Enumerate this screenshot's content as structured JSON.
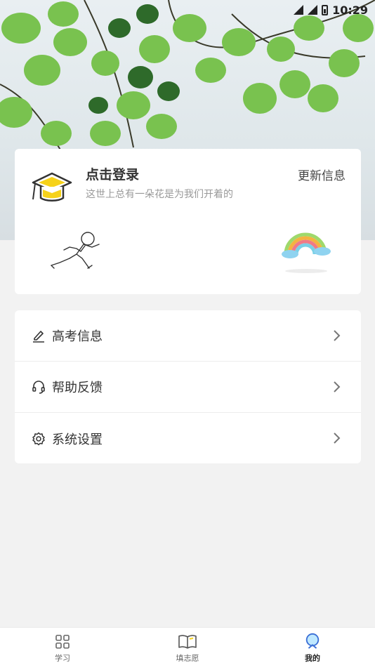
{
  "status_bar": {
    "time": "10:29"
  },
  "profile": {
    "title": "点击登录",
    "subtitle": "这世上总有一朵花是为我们开着的",
    "update_link": "更新信息"
  },
  "menu": {
    "items": [
      {
        "label": "高考信息",
        "icon": "edit-icon"
      },
      {
        "label": "帮助反馈",
        "icon": "headset-icon"
      },
      {
        "label": "系统设置",
        "icon": "gear-icon"
      }
    ]
  },
  "bottom_nav": {
    "items": [
      {
        "label": "学习",
        "icon": "grid-icon"
      },
      {
        "label": "填志愿",
        "icon": "book-icon"
      },
      {
        "label": "我的",
        "icon": "profile-icon",
        "active": true
      }
    ]
  },
  "colors": {
    "accent_active": "#3b6fd6",
    "leaf_green": "#6fbf4a"
  }
}
